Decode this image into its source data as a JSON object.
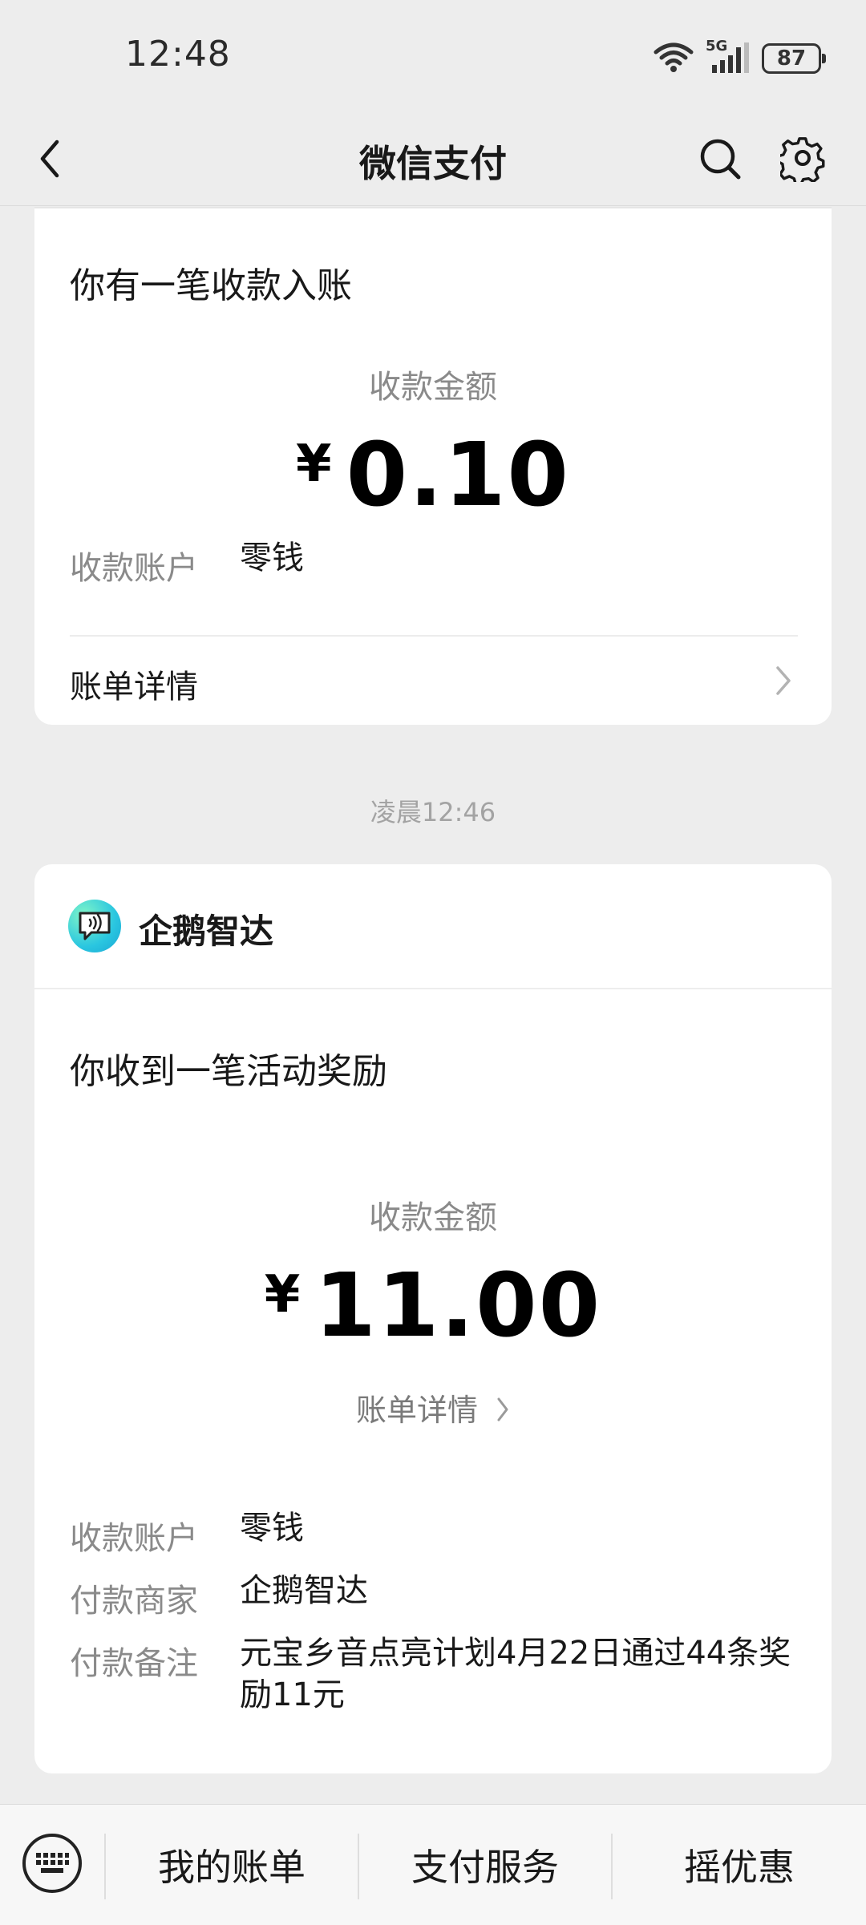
{
  "status_bar": {
    "time": "12:48",
    "network": "5G",
    "battery": "87"
  },
  "nav": {
    "title": "微信支付",
    "back_icon": "chevron-left-icon",
    "search_icon": "search-icon",
    "settings_icon": "gear-icon"
  },
  "card1": {
    "heading": "你有一笔收款入账",
    "amount_label": "收款金额",
    "currency": "¥",
    "amount": "0.10",
    "account_label": "收款账户",
    "account_value": "零钱",
    "bill_details": "账单详情"
  },
  "timestamp": "凌晨12:46",
  "card2": {
    "merchant": "企鹅智达",
    "heading": "你收到一笔活动奖励",
    "amount_label": "收款金额",
    "currency": "¥",
    "amount": "11.00",
    "bill_details": "账单详情",
    "rows": [
      {
        "label": "收款账户",
        "value": "零钱"
      },
      {
        "label": "付款商家",
        "value": "企鹅智达"
      },
      {
        "label": "付款备注",
        "value": "元宝乡音点亮计划4月22日通过44条奖励11元"
      }
    ]
  },
  "bottom_menu": {
    "items": [
      "我的账单",
      "支付服务",
      "摇优惠"
    ]
  },
  "colors": {
    "background": "#ededed",
    "card": "#ffffff",
    "label_gray": "#8a8a8a"
  }
}
